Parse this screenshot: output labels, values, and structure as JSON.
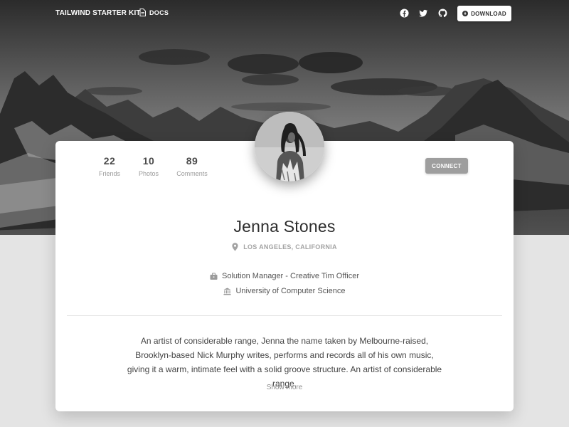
{
  "nav": {
    "brand": "TAILWIND STARTER KIT",
    "docs_label": "DOCS",
    "social": [
      "facebook-icon",
      "twitter-icon",
      "github-icon"
    ],
    "download_label": "DOWNLOAD"
  },
  "profile": {
    "stats": [
      {
        "value": "22",
        "label": "Friends"
      },
      {
        "value": "10",
        "label": "Photos"
      },
      {
        "value": "89",
        "label": "Comments"
      }
    ],
    "connect_label": "CONNECT",
    "name": "Jenna Stones",
    "location": "LOS ANGELES, CALIFORNIA",
    "job": "Solution Manager - Creative Tim Officer",
    "education": "University of Computer Science",
    "bio": "An artist of considerable range, Jenna the name taken by Melbourne-raised, Brooklyn-based Nick Murphy writes, performs and records all of his own music, giving it a warm, intimate feel with a solid groove structure. An artist of considerable range.",
    "show_more": "Show more"
  },
  "colors": {
    "page_bg": "#e4e4e4",
    "card_bg": "#ffffff",
    "connect_bg": "#9e9e9e",
    "text_dark": "#2d2d2d"
  }
}
